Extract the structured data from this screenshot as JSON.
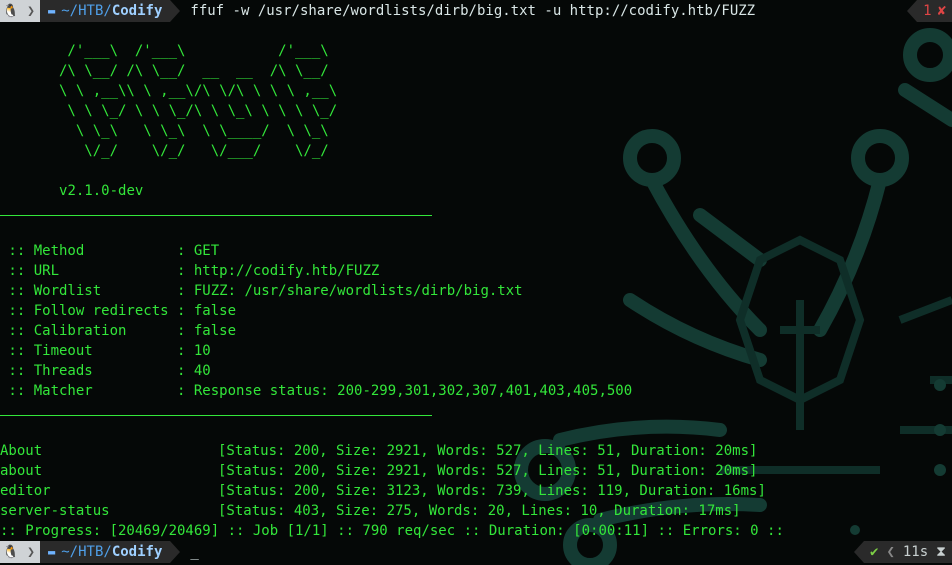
{
  "top_prompt": {
    "os_icon": "linux-tux-icon",
    "folder_icon": "folder-icon",
    "path_prefix": "~/HTB/",
    "path_current": "Codify",
    "command": "ffuf -w /usr/share/wordlists/dirb/big.txt -u http://codify.htb/FUZZ",
    "exit_code": "1",
    "error_icon": "x-icon"
  },
  "banner": [
    "        /'___\\  /'___\\           /'___\\",
    "       /\\ \\__/ /\\ \\__/  __  __  /\\ \\__/",
    "       \\ \\ ,__\\\\ \\ ,__\\/\\ \\/\\ \\ \\ \\ ,__\\",
    "        \\ \\ \\_/ \\ \\ \\_/\\ \\ \\_\\ \\ \\ \\ \\_/",
    "         \\ \\_\\   \\ \\_\\  \\ \\____/  \\ \\_\\",
    "          \\/_/    \\/_/   \\/___/    \\/_/"
  ],
  "version": "v2.1.0-dev",
  "config": [
    {
      "key": " :: Method           ",
      "value": ": GET"
    },
    {
      "key": " :: URL              ",
      "value": ": http://codify.htb/FUZZ"
    },
    {
      "key": " :: Wordlist         ",
      "value": ": FUZZ: /usr/share/wordlists/dirb/big.txt"
    },
    {
      "key": " :: Follow redirects ",
      "value": ": false"
    },
    {
      "key": " :: Calibration      ",
      "value": ": false"
    },
    {
      "key": " :: Timeout          ",
      "value": ": 10"
    },
    {
      "key": " :: Threads          ",
      "value": ": 40"
    },
    {
      "key": " :: Matcher          ",
      "value": ": Response status: 200-299,301,302,307,401,403,405,500"
    }
  ],
  "results": [
    {
      "path": "About",
      "info": "[Status: 200, Size: 2921, Words: 527, Lines: 51, Duration: 20ms]"
    },
    {
      "path": "about",
      "info": "[Status: 200, Size: 2921, Words: 527, Lines: 51, Duration: 20ms]"
    },
    {
      "path": "editor",
      "info": "[Status: 200, Size: 3123, Words: 739, Lines: 119, Duration: 16ms]"
    },
    {
      "path": "server-status",
      "info": "[Status: 403, Size: 275, Words: 20, Lines: 10, Duration: 17ms]"
    }
  ],
  "progress": ":: Progress: [20469/20469] :: Job [1/1] :: 790 req/sec :: Duration: [0:00:11] :: Errors: 0 ::",
  "bottom_prompt": {
    "os_icon": "linux-tux-icon",
    "folder_icon": "folder-icon",
    "path_prefix": "~/HTB/",
    "path_current": "Codify",
    "cursor": "_",
    "status_icon": "check-icon",
    "elapsed": "11s",
    "hourglass_icon": "hourglass-icon"
  },
  "colors": {
    "terminal_green": "#33e63a",
    "background": "#050807",
    "path_blue": "#4f9fe8",
    "error_red": "#e04545",
    "success_green": "#7ccf45"
  }
}
